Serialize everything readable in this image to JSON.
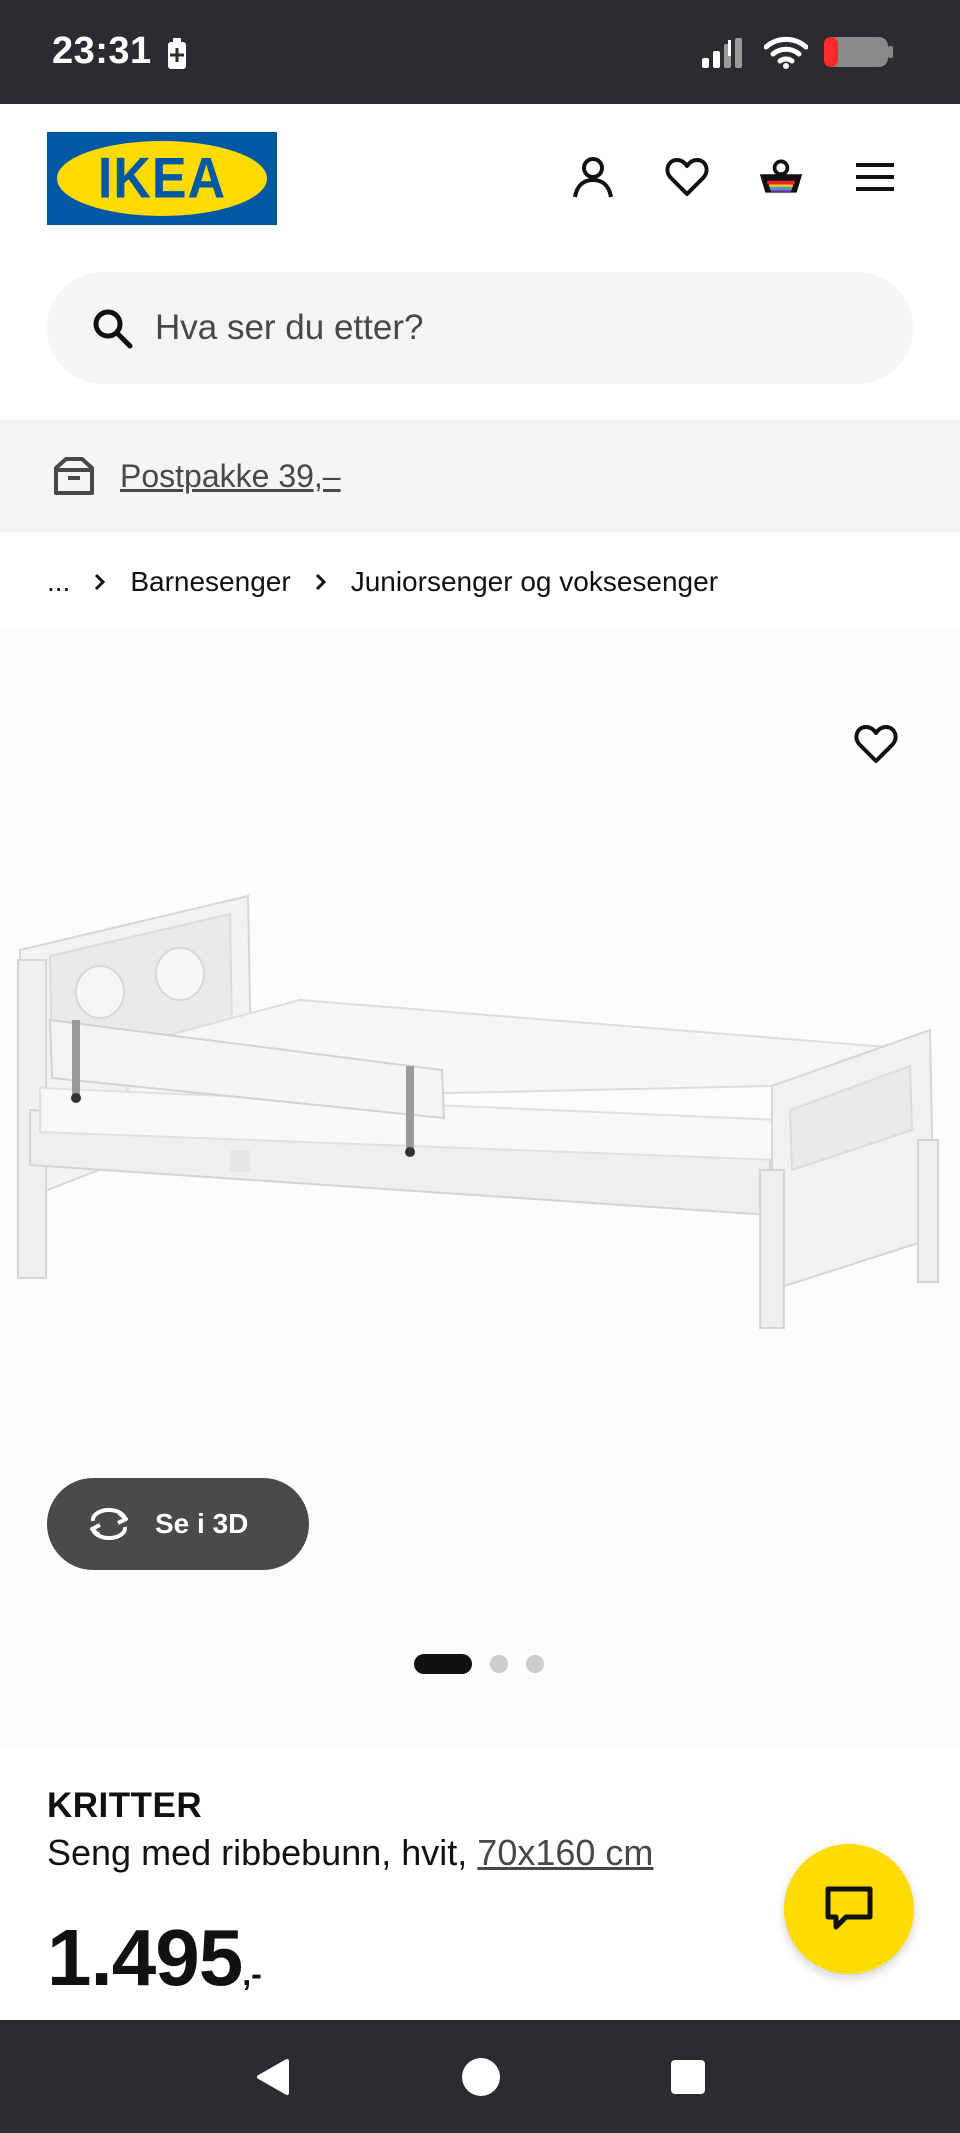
{
  "status_bar": {
    "time": "23:31"
  },
  "header": {
    "logo_text": "IKEA",
    "icons": [
      "account-icon",
      "heart-icon",
      "basket-icon",
      "menu-icon"
    ]
  },
  "search": {
    "placeholder": "Hva ser du etter?"
  },
  "delivery": {
    "label": "Postpakke 39,–"
  },
  "breadcrumb": {
    "ellipsis": "...",
    "items": [
      "Barnesenger",
      "Juniorsenger og voksesenger"
    ]
  },
  "gallery": {
    "view_3d_label": "Se i 3D",
    "slide_count": 3,
    "active_slide": 1
  },
  "product": {
    "name": "KRITTER",
    "description": "Seng med ribbebunn, hvit,",
    "dimension": "70x160 cm",
    "price": "1.495",
    "price_suffix": ",-"
  },
  "colors": {
    "ikea_blue": "#0058a3",
    "ikea_yellow": "#ffdb00",
    "status_bar": "#2b2c30"
  }
}
